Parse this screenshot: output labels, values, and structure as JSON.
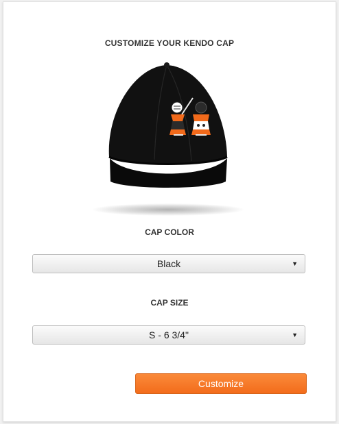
{
  "page": {
    "title": "CUSTOMIZE YOUR KENDO CAP"
  },
  "preview": {
    "image_name": "kendo-cap-preview",
    "cap_color": "#0d0d0d",
    "accent_color": "#f26a1b"
  },
  "color_field": {
    "label": "CAP COLOR",
    "selected": "Black"
  },
  "size_field": {
    "label": "CAP SIZE",
    "selected": "S - 6 3/4\""
  },
  "actions": {
    "customize_label": "Customize",
    "accent_color": "#f47b27"
  }
}
